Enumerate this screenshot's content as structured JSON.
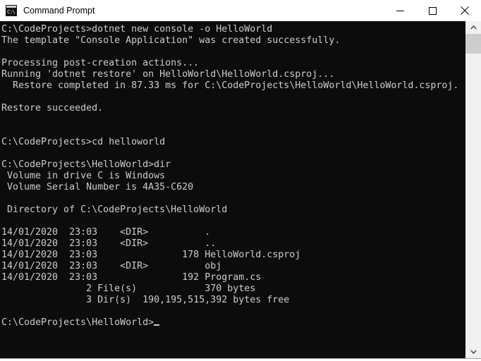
{
  "window": {
    "title": "Command Prompt",
    "icon": "command-prompt-icon",
    "icon_text": "C:\\.",
    "background_color": "#0c0c0c",
    "text_color": "#cccccc",
    "titlebar_color": "#ffffff"
  },
  "controls": {
    "minimize_label": "Minimize",
    "maximize_label": "Maximize",
    "close_label": "Close"
  },
  "scrollbar": {
    "up_arrow": "▲",
    "down_arrow": "▼",
    "thumb_position": "top"
  },
  "terminal": {
    "content": "C:\\CodeProjects>dotnet new console -o HelloWorld\nThe template \"Console Application\" was created successfully.\n\nProcessing post-creation actions...\nRunning 'dotnet restore' on HelloWorld\\HelloWorld.csproj...\n  Restore completed in 87.33 ms for C:\\CodeProjects\\HelloWorld\\HelloWorld.csproj.\n\nRestore succeeded.\n\n\nC:\\CodeProjects>cd helloworld\n\nC:\\CodeProjects\\HelloWorld>dir\n Volume in drive C is Windows\n Volume Serial Number is 4A35-C620\n\n Directory of C:\\CodeProjects\\HelloWorld\n\n14/01/2020  23:03    <DIR>          .\n14/01/2020  23:03    <DIR>          ..\n14/01/2020  23:03               178 HelloWorld.csproj\n14/01/2020  23:03    <DIR>          obj\n14/01/2020  23:03               192 Program.cs\n               2 File(s)            370 bytes\n               3 Dir(s)  190,195,515,392 bytes free\n\n",
    "prompt": "C:\\CodeProjects\\HelloWorld>",
    "commands": [
      "dotnet new console -o HelloWorld",
      "cd helloworld",
      "dir"
    ],
    "volume_name": "Windows",
    "volume_serial": "4A35-C620",
    "directory": "C:\\CodeProjects\\HelloWorld",
    "listing": [
      {
        "date": "14/01/2020",
        "time": "23:03",
        "kind": "<DIR>",
        "size": "",
        "name": "."
      },
      {
        "date": "14/01/2020",
        "time": "23:03",
        "kind": "<DIR>",
        "size": "",
        "name": ".."
      },
      {
        "date": "14/01/2020",
        "time": "23:03",
        "kind": "",
        "size": "178",
        "name": "HelloWorld.csproj"
      },
      {
        "date": "14/01/2020",
        "time": "23:03",
        "kind": "<DIR>",
        "size": "",
        "name": "obj"
      },
      {
        "date": "14/01/2020",
        "time": "23:03",
        "kind": "",
        "size": "192",
        "name": "Program.cs"
      }
    ],
    "file_count": "2",
    "file_bytes": "370",
    "dir_count": "3",
    "free_bytes": "190,195,515,392"
  }
}
